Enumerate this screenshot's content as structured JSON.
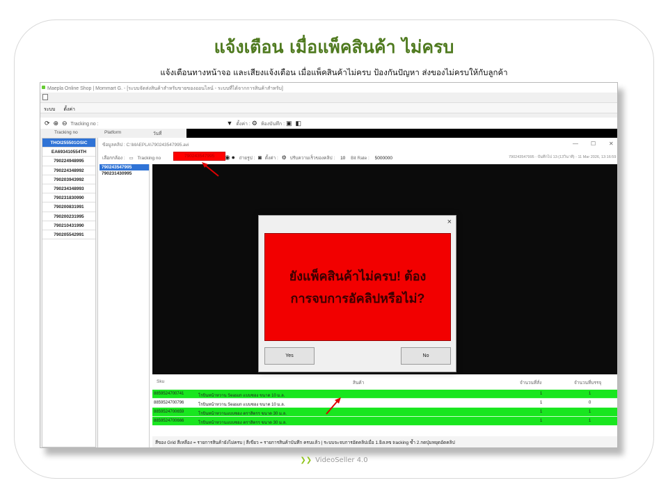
{
  "page": {
    "heading": "แจ้งเตือน เมื่อแพ็คสินค้า ไม่ครบ",
    "subheading": "แจ้งเตือนทางหน้าจอ และเสียงแจ้งเตือน เมื่อแพ็คสินค้าไม่ครบ ป้องกันปัญหา ส่งของไม่ครบให้กับลูกค้า",
    "footer": "VideoSeller 4.0",
    "footer_icon": "leaf-icon"
  },
  "app": {
    "title": "Maepla Online Shop | Mommart G. - [ระบบจัดส่งสินค้าสำหรับขายของออนไลน์ - ระบบที่ได้จากการสินค้าสำหรับ]",
    "menu": [
      "ระบบ",
      "ตั้งค่า"
    ],
    "toolbar": {
      "tracking_label": "Tracking no :",
      "settings_label": "ตั้งค่า :",
      "record_label": "ห้องบันทึก :"
    },
    "columns": {
      "tracking": "Tracking no",
      "platform": "Platform",
      "date": "วันที่"
    },
    "tracking_list": [
      "THOI255501OSIC",
      "EA693410554TH",
      "790224948995",
      "790224348992",
      "790203943992",
      "790234348993",
      "790231830990",
      "790200831991",
      "790200231995",
      "790210431990",
      "790205542991"
    ]
  },
  "panel": {
    "title": "ข้อมูลคลิป : C:\\MAEPLA\\790243547995.avi",
    "camera_label": "เลือกกล้อง :",
    "tracking_label": "Tracking no",
    "tracking_value": "790243547995",
    "photo_label": "ถ่ายรูป :",
    "settings_label": "ตั้งค่า :",
    "speed_label": "ปรับความเร็วของคลิป :",
    "speed_value": "10",
    "bitrate_label": "Bit Rate :",
    "bitrate_value": "5000000",
    "info": "790243547995 - บันทึกไป 13:(13วินาที) - 11 Mar 2026, 13:16:59",
    "window_min": "—",
    "window_max": "☐",
    "window_close": "✕",
    "clips": [
      "790243547995",
      "790231430995"
    ]
  },
  "grid": {
    "headers": {
      "sku": "Sku",
      "product": "สินค้า",
      "ordered": "จำนวนที่สั่ง",
      "packed": "จำนวนที่บรรจุ"
    },
    "rows": [
      {
        "sku": "8859524700741",
        "name": "โรบินหน้าหวาน Seasun แบบซอง ขนาด 10 ม.ล.",
        "ordered": "1",
        "packed": "1",
        "complete": true
      },
      {
        "sku": "8859524700796",
        "name": "โรบินหน้าหวาน Seasun แบบซอง ขนาด 10 ม.ล.",
        "ordered": "1",
        "packed": "0",
        "complete": false
      },
      {
        "sku": "8859524700659",
        "name": "โรบินหน้าหวานแบบซอง ตราสิตรร ขนาด 30 ม.ล.",
        "ordered": "1",
        "packed": "1",
        "complete": true
      },
      {
        "sku": "8859524700666",
        "name": "โรบินหน้าหวานแบบซอง ตราสิตรร ขนาด 30 ม.ล.",
        "ordered": "1",
        "packed": "1",
        "complete": true
      }
    ],
    "status": "สีของ Grid สีเหลือง = รายการสินค้ายังไม่ครบ  |  สีเขียว = รายการสินค้าบันทึก ครบแล้ว  |  ระบบจะจบการอัดคลิปเมื่อ 1.ยิงเลข tracking ซ้ำ 2.กดปุ่มหยุดอัดคลิป"
  },
  "dialog": {
    "message_line1": "ยังแพ็คสินค้าไม่ครบ! ต้อง",
    "message_line2": "การจบการอัคลิปหรือไม่?",
    "yes": "Yes",
    "no": "No",
    "close": "×",
    "alert_color": "#f20000"
  }
}
